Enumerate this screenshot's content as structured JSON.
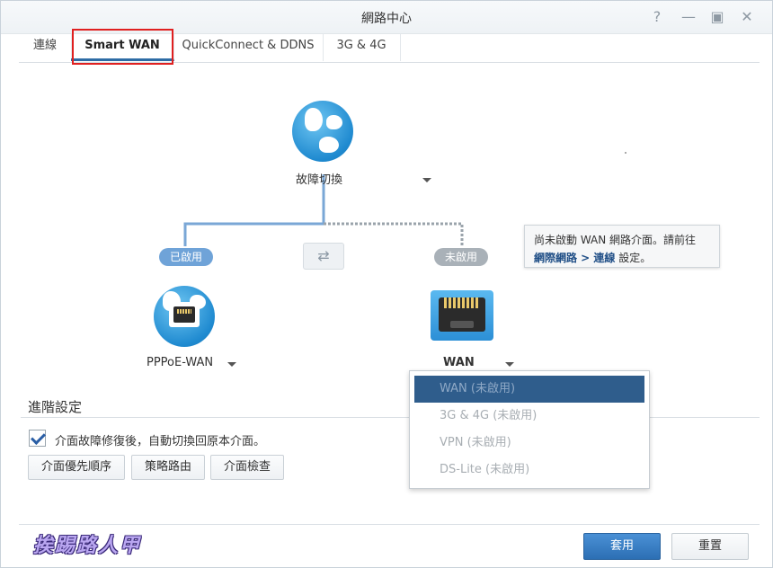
{
  "window": {
    "title": "網路中心",
    "controls": [
      "help-icon",
      "minimize-icon",
      "maximize-icon",
      "close-icon"
    ]
  },
  "tabs": [
    {
      "label": "連線",
      "active": false
    },
    {
      "label": "Smart WAN",
      "active": true
    },
    {
      "label": "QuickConnect & DDNS",
      "active": false
    },
    {
      "label": "3G & 4G",
      "active": false
    }
  ],
  "diagram": {
    "top_node": {
      "icon": "globe-icon",
      "label": "故障切換"
    },
    "left_status": "已啟用",
    "right_status": "未啟用",
    "left_node": {
      "icon": "globe-ethernet-icon",
      "label": "PPPoE-WAN"
    },
    "right_node": {
      "icon": "ethernet-port-icon",
      "label": "WAN"
    },
    "tooltip": {
      "line1": "尚未啟動 WAN 網路介面。請前往",
      "link": "網際網路 > 連線",
      "suffix": " 設定。"
    },
    "colors": {
      "active_line": "#7aa7d6",
      "inactive_line": "#9aa3ab",
      "active_pill": "#6fa3d8",
      "inactive_pill": "#a9b1b8"
    }
  },
  "dropdown": {
    "options": [
      {
        "label": "WAN (未啟用)",
        "selected": true
      },
      {
        "label": "3G & 4G (未啟用)",
        "selected": false
      },
      {
        "label": "VPN (未啟用)",
        "selected": false
      },
      {
        "label": "DS-Lite (未啟用)",
        "selected": false
      }
    ]
  },
  "advanced": {
    "title": "進階設定",
    "checkbox_label": "介面故障修復後，自動切換回原本介面。",
    "checkbox_checked": true,
    "buttons": [
      "介面優先順序",
      "策略路由",
      "介面檢查"
    ]
  },
  "footer": {
    "apply_label": "套用",
    "reset_label": "重置",
    "watermark": "挨踢路人甲"
  }
}
